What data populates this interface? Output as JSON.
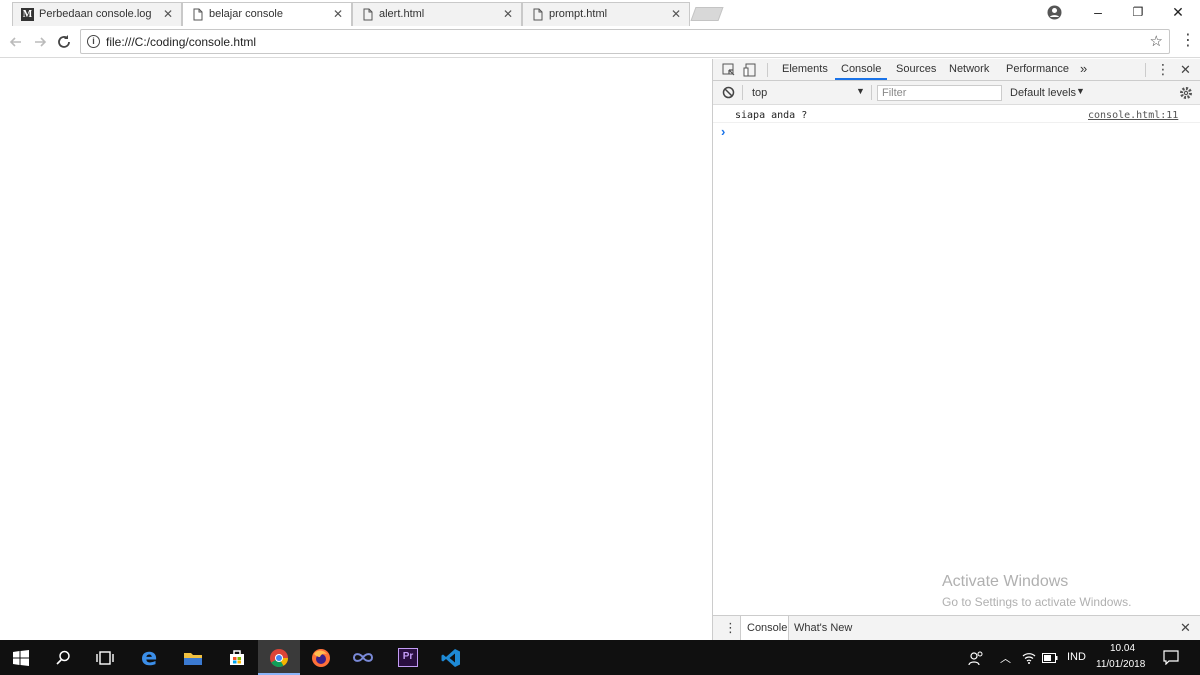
{
  "browser": {
    "tabs": [
      {
        "title": "Perbedaan console.log, p",
        "icon": "medium-logo-icon",
        "active": false
      },
      {
        "title": "belajar console",
        "icon": "page-icon",
        "active": true
      },
      {
        "title": "alert.html",
        "icon": "page-icon",
        "active": false
      },
      {
        "title": "prompt.html",
        "icon": "page-icon",
        "active": false
      }
    ],
    "tab_close": "✕",
    "medium_logo_letter": "M",
    "url": "file:///C:/coding/console.html",
    "window_controls": {
      "minimize": "–",
      "restore": "❐",
      "close": "✕"
    }
  },
  "devtools": {
    "tabs": [
      "Elements",
      "Console",
      "Sources",
      "Network",
      "Performance"
    ],
    "more_tabs": "»",
    "active_tab": "Console",
    "context": "top",
    "filter_placeholder": "Filter",
    "levels": "Default levels",
    "messages": [
      {
        "text": "siapa anda ?",
        "source": "console.html:11"
      }
    ],
    "prompt_symbol": "›",
    "drawer_tabs": [
      "Console",
      "What's New"
    ]
  },
  "watermark": {
    "title": "Activate Windows",
    "subtitle": "Go to Settings to activate Windows."
  },
  "taskbar": {
    "language": "IND",
    "time": "10.04",
    "date": "11/01/2018",
    "apps": [
      "start",
      "search",
      "task-view",
      "edge",
      "file-explorer",
      "store",
      "chrome",
      "firefox",
      "infinity",
      "premiere",
      "vscode"
    ]
  },
  "colors": {
    "accent": "#1a73e8",
    "taskbar": "#101010"
  }
}
